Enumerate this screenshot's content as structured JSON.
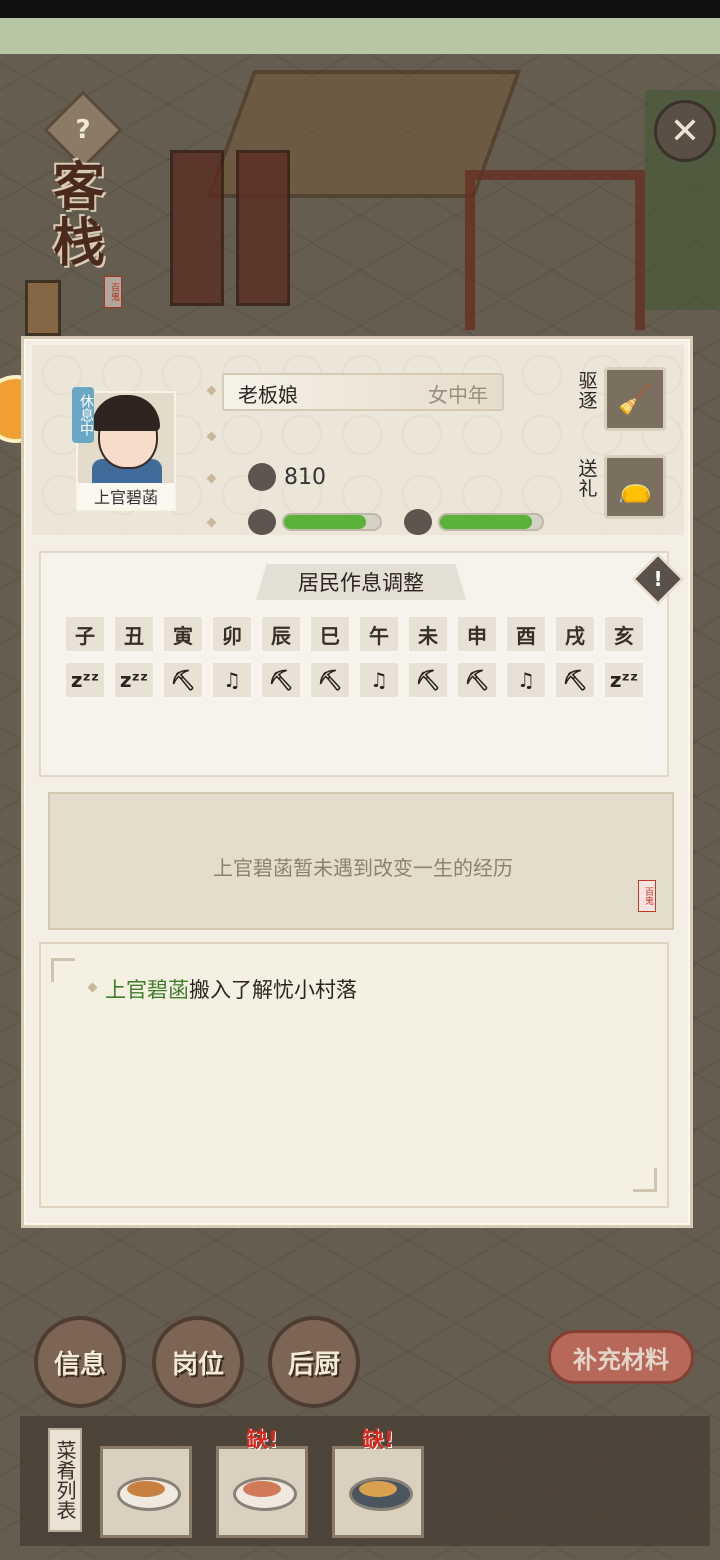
{
  "inn": {
    "title": "客栈",
    "seal_text": "百鬼",
    "help_symbol": "?",
    "close_symbol": "✕"
  },
  "resident": {
    "name": "上官碧菡",
    "status": "休息中",
    "occupation": "老板娘",
    "category": "女中年",
    "coins": "810",
    "health_level": 0.85,
    "mood_level": 0.9,
    "colors": {
      "bar_fill": "#59b33a",
      "status_tag": "#6aa7c4"
    }
  },
  "actions": {
    "expel_label": "驱逐",
    "gift_label": "送礼",
    "expel_icon": "broom-icon",
    "gift_icon": "gift-bag-icon"
  },
  "schedule": {
    "title": "居民作息调整",
    "warn_symbol": "!",
    "hours": [
      "子",
      "丑",
      "寅",
      "卯",
      "辰",
      "巳",
      "午",
      "未",
      "申",
      "酉",
      "戌",
      "亥"
    ],
    "activity_glyphs": [
      "zᶻᶻ",
      "zᶻᶻ",
      "⛏",
      "♫",
      "⛏",
      "⛏",
      "♫",
      "⛏",
      "⛏",
      "♫",
      "⛏",
      "zᶻᶻ"
    ],
    "activity_types": [
      "sleep",
      "sleep",
      "work",
      "leisure",
      "work",
      "work",
      "leisure",
      "work",
      "work",
      "leisure",
      "work",
      "sleep"
    ]
  },
  "life_event": {
    "text": "上官碧菡暂未遇到改变一生的经历",
    "seal_text": "百鬼"
  },
  "log": {
    "entry_name": "上官碧菡",
    "entry_text": "搬入了解忧小村落"
  },
  "bottom": {
    "info_label": "信息",
    "post_label": "岗位",
    "kitchen_label": "后厨",
    "refill_label": "补充材料",
    "dish_list_label": "菜肴列表",
    "missing_label": "缺!"
  }
}
